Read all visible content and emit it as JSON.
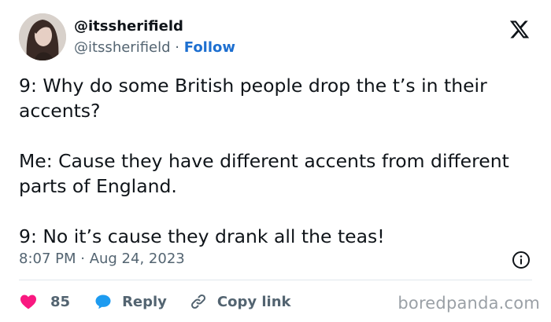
{
  "author": {
    "display_name": "@itssherifield",
    "handle": "@itssherifield",
    "separator": "·",
    "follow_label": "Follow"
  },
  "tweet": {
    "paragraphs": [
      "9: Why do some British people drop the t’s in their accents?",
      "Me: Cause they have different accents from different parts of England.",
      "9: No it’s cause they drank all the teas!"
    ],
    "timestamp": "8:07 PM · Aug 24, 2023"
  },
  "actions": {
    "like_count": "85",
    "reply_label": "Reply",
    "copy_link_label": "Copy link"
  },
  "watermark": "boredpanda.com",
  "colors": {
    "text": "#0f1419",
    "muted": "#536471",
    "link": "#1d6fd0",
    "like": "#f91880",
    "reply": "#1d9bf0",
    "divider": "#e1e8ed"
  },
  "icons": {
    "platform": "x-logo-icon",
    "info": "info-icon",
    "like": "heart-icon",
    "reply": "speech-bubble-icon",
    "copy": "link-icon"
  }
}
